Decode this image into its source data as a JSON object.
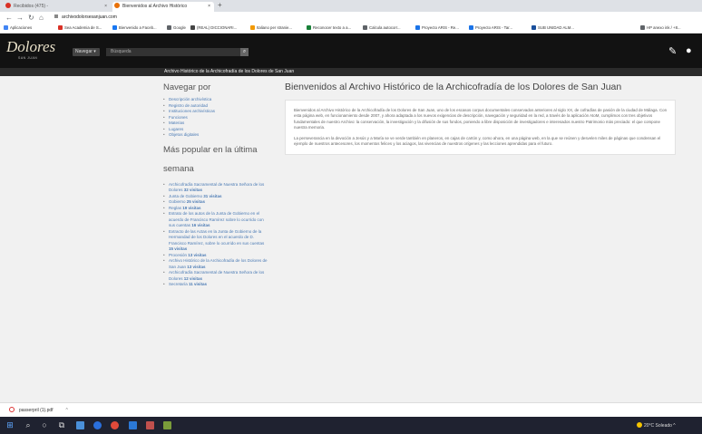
{
  "browser": {
    "tabs": [
      {
        "label": "Recibidos (475) - "
      },
      {
        "label": "Bienvenidos al Archivo Histórico"
      }
    ],
    "new_tab": "+",
    "address": "archivodolorsesanjuan.com",
    "bookmarks": [
      {
        "label": "Aplicaciones",
        "color": "#4285f4"
      },
      {
        "label": "Sea Academia de S...",
        "color": "#d93025"
      },
      {
        "label": "Bienvenido a Faceb...",
        "color": "#1877f2"
      },
      {
        "label": "Google",
        "color": "#5f6368"
      },
      {
        "label": "(REAL) DICCIONARI...",
        "color": "#444444"
      },
      {
        "label": "Italiano per stranie...",
        "color": "#f29900"
      },
      {
        "label": "Reconocer texto a a...",
        "color": "#188038"
      },
      {
        "label": "Calcula autocorr...",
        "color": "#5f6368"
      },
      {
        "label": "Proyecto ARIS - Re...",
        "color": "#1a73e8"
      },
      {
        "label": "Proyecto ARIS - Tar...",
        "color": "#1a73e8"
      },
      {
        "label": "SUB UNIDAD ALM...",
        "color": "#1a4f9c"
      },
      {
        "label": "HP anexo ink / +8...",
        "color": "#5f6368"
      }
    ]
  },
  "site": {
    "logo_text": "Dolores",
    "logo_sub": "SAN JUAN",
    "nav_button": "Navegar",
    "search_placeholder": "Búsqueda",
    "breadcrumb": "Archivo Histórico de la Archicofradía de los Dolores de San Juan"
  },
  "sidebar": {
    "nav_heading": "Navegar por",
    "nav_items": [
      "Descripción archivística",
      "Registro de autoridad",
      "Instituciones archivísticas",
      "Funciones",
      "Materias",
      "Lugares",
      "Objetos digitales"
    ],
    "popular_heading_line1": "Más popular en la última",
    "popular_heading_line2": "semana",
    "popular_items": [
      {
        "title": "Archicofradía Sacramental de Nuestra Señora de los Dolores",
        "visits": "32 visitas"
      },
      {
        "title": "Junta de Gobierno",
        "visits": "31 visitas"
      },
      {
        "title": "Gobierno",
        "visits": "25 visitas"
      },
      {
        "title": "Reglas",
        "visits": "19 visitas"
      },
      {
        "title": "Estrato de los autos de la Junta de Gobierno en el acuerdo de Francisco Ramírez sobre lo ocurrido con sus cuentas",
        "visits": "16 visitas"
      },
      {
        "title": "Extracto de las Actas en la Junta de Gobierno de la Hermandad de los Dolores en el acuerdo de D. Francisco Ramírez, sobre lo ocurrido en sus cuentas",
        "visits": "15 visitas"
      },
      {
        "title": "Procesión",
        "visits": "13 visitas"
      },
      {
        "title": "Archivo Histórico de la Archicofradía de los Dolores de San Juan",
        "visits": "13 visitas"
      },
      {
        "title": "Archicofradía Sacramental de Nuestra Señora de los Dolores",
        "visits": "12 visitas"
      },
      {
        "title": "Secretaría",
        "visits": "11 visitas"
      }
    ]
  },
  "main": {
    "title": "Bienvenidos al Archivo Histórico de la Archicofradía de los Dolores de San Juan",
    "paragraph1": "Bienvenidos al Archivo Histórico de la Archicofradía de los Dolores de San Juan, uno de los escasos corpus documentales conservados anteriores al siglo XX, de cofradías de pasión de la ciudad de Málaga. Con esta página web, en funcionamiento desde 2007, y ahora adaptada a los nuevos exigencias de descripción, navegación y seguridad en la red, a través de la aplicación AtoM, cumplimos con tres objetivos fundamentales de nuestro Archivo: la conservación, la investigación y la difusión de sus fondos, poniendo a libre disposición de investigadores e interesados nuestro Patrimonio más preciado: el que compone nuestra memoria.",
    "paragraph2": "La perseverancia en la devoción a Jesús y a María se ve verde también en planeros, en cajas de cartón y, como ahora, en una página web, en la que se reúnen y desvelen miles de páginas que condensan el ejemplo de nuestros antecesores, los momentos felices y los aciagos, las vivencias de nuestros orígenes y las lecciones aprendidas para el futuro."
  },
  "downloads": {
    "file": "passerpril (1).pdf",
    "chevron": "^"
  },
  "taskbar": {
    "weather": "20°C  Soleado  ^"
  }
}
